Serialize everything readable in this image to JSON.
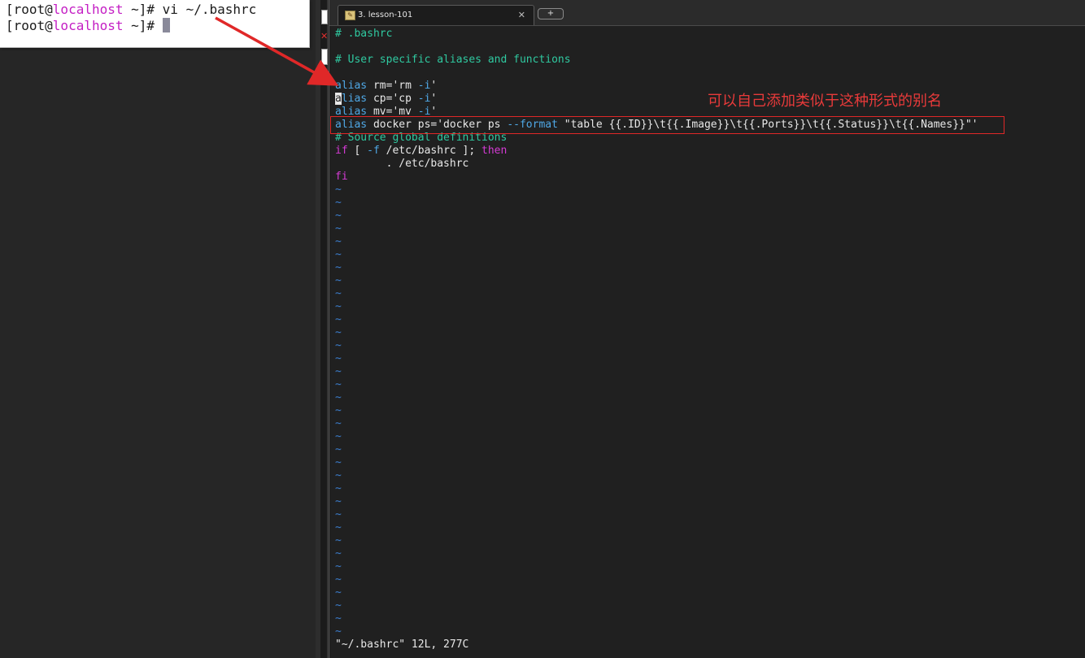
{
  "left_terminal": {
    "lines": [
      {
        "user": "[root@",
        "host": "localhost",
        "rest": " ~]# vi ~/.bashrc"
      },
      {
        "user": "[root@",
        "host": "localhost",
        "rest": " ~]# "
      }
    ]
  },
  "tab": {
    "icon": "terminal-session-icon",
    "label": "3. lesson-101",
    "close": "✕",
    "new_tab": "+"
  },
  "editor": {
    "header_comment": "# .bashrc",
    "user_comment": "# User specific aliases and functions",
    "aliases": [
      {
        "kw": "alias",
        "name": " rm='rm ",
        "flag": "-i",
        "end": "'"
      },
      {
        "kw": "lias",
        "cursor": "a",
        "name": " cp='cp ",
        "flag": "-i",
        "end": "'"
      },
      {
        "kw": "alias",
        "name": " mv='mv ",
        "flag": "-i",
        "end": "'"
      }
    ],
    "docker_alias": {
      "kw": "alias",
      "pre": " docker ps='docker ps ",
      "flag": "--format",
      "post": " \"table {{.ID}}\\t{{.Image}}\\t{{.Ports}}\\t{{.Status}}\\t{{.Names}}\"'"
    },
    "source_comment": "# Source global definitions",
    "if_line": {
      "kw": "if",
      "mid": " [ ",
      "flag": "-f",
      "path": " /etc/bashrc ]; ",
      "then": "then"
    },
    "dot_line": "        . /etc/bashrc",
    "fi": "fi",
    "tilde": "~",
    "status": "\"~/.bashrc\" 12L, 277C"
  },
  "annotation": {
    "text": "可以自己添加类似于这种形式的别名",
    "color": "#e83a3a"
  },
  "colors": {
    "comment": "#2fc9a0",
    "keyword": "#4fa8e6",
    "control": "#d43bd4",
    "tilde": "#3c7fd0",
    "hostname": "#c41ec4"
  }
}
